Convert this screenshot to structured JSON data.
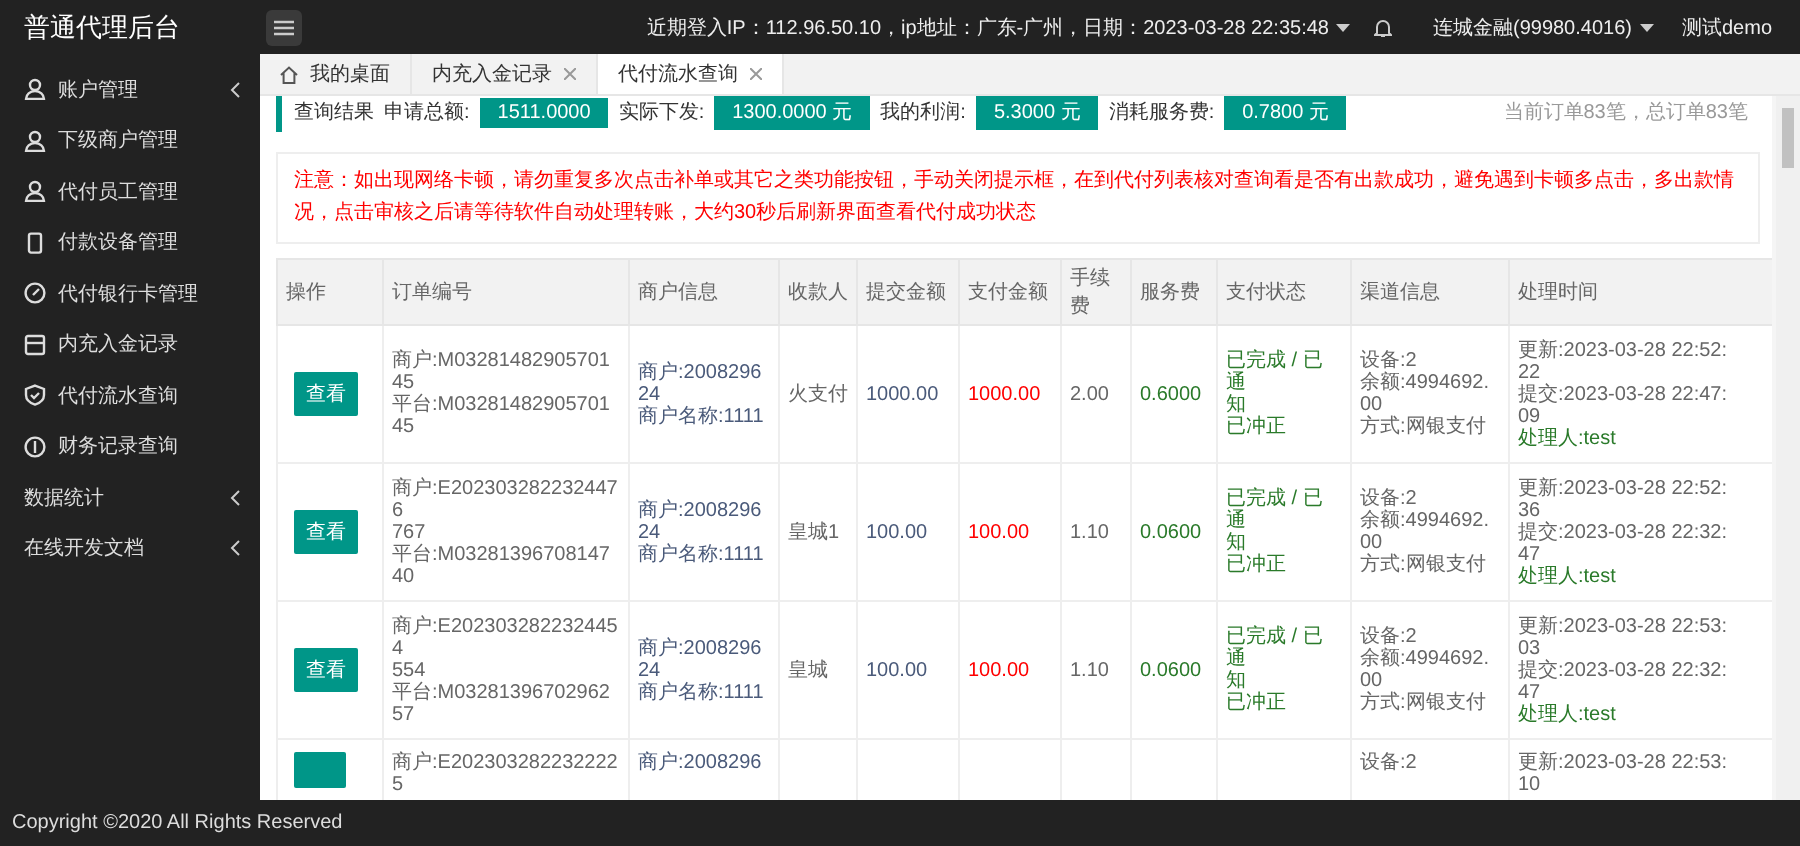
{
  "header": {
    "title": "普通代理后台",
    "login_info": "近期登入IP：112.96.50.10，ip地址：广东-广州，日期：2023-03-28 22:35:48",
    "account": "连城金融(99980.4016)",
    "user": "测试demo"
  },
  "sidebar": {
    "items": [
      {
        "label": "账户管理",
        "has_children": true
      },
      {
        "label": "下级商户管理",
        "has_children": false
      },
      {
        "label": "代付员工管理",
        "has_children": false
      },
      {
        "label": "付款设备管理",
        "has_children": false
      },
      {
        "label": "代付银行卡管理",
        "has_children": false
      },
      {
        "label": "内充入金记录",
        "has_children": false
      },
      {
        "label": "代付流水查询",
        "has_children": false
      },
      {
        "label": "财务记录查询",
        "has_children": false
      },
      {
        "label": "数据统计",
        "has_children": true
      },
      {
        "label": "在线开发文档",
        "has_children": true
      }
    ]
  },
  "tabs": [
    {
      "label": "我的桌面",
      "closable": false,
      "selected": false
    },
    {
      "label": "内充入金记录",
      "closable": true,
      "selected": false
    },
    {
      "label": "代付流水查询",
      "closable": true,
      "selected": true
    }
  ],
  "summary": {
    "title": "查询结果",
    "items": [
      {
        "label": "申请总额:",
        "value": "1511.0000"
      },
      {
        "label": "实际下发:",
        "value": "1300.0000 元"
      },
      {
        "label": "我的利润:",
        "value": "5.3000 元"
      },
      {
        "label": "消耗服务费:",
        "value": "0.7800 元"
      }
    ],
    "count": "当前订单83笔，总订单83笔"
  },
  "notice": "注意：如出现网络卡顿，请勿重复多次点击补单或其它之类功能按钮，手动关闭提示框，在到代付列表核对查询看是否有出款成功，避免遇到卡顿多点击，多出款情况，点击审核之后请等待软件自动处理转账，大约30秒后刷新界面查看代付成功状态",
  "table": {
    "columns": [
      "操作",
      "订单编号",
      "商户信息",
      "收款人",
      "提交金额",
      "支付金额",
      "手续费",
      "服务费",
      "支付状态",
      "渠道信息",
      "处理时间"
    ],
    "rows": [
      {
        "action": "查看",
        "order": [
          "商户:M0328148290570145",
          "平台:M0328148290570145"
        ],
        "merchant": [
          "商户:2008296",
          "24",
          "商户名称:1111"
        ],
        "payee": "火支付",
        "submitted": "1000.00",
        "paid": "1000.00",
        "fee": "2.00",
        "service": "0.6000",
        "status": [
          "已完成 / 已通",
          "知",
          "已冲正"
        ],
        "channel": [
          "设备:2",
          "余额:4994692.",
          "00",
          "方式:网银支付"
        ],
        "time": [
          "更新:2023-03-28 22:52:",
          "22",
          "提交:2023-03-28 22:47:",
          "09"
        ],
        "handler": "处理人:test"
      },
      {
        "action": "查看",
        "order": [
          "商户:E2023032822324476",
          "767",
          "平台:M0328139670814740"
        ],
        "merchant": [
          "商户:2008296",
          "24",
          "商户名称:1111"
        ],
        "payee": "皇城1",
        "submitted": "100.00",
        "paid": "100.00",
        "fee": "1.10",
        "service": "0.0600",
        "status": [
          "已完成 / 已通",
          "知",
          "已冲正"
        ],
        "channel": [
          "设备:2",
          "余额:4994692.",
          "00",
          "方式:网银支付"
        ],
        "time": [
          "更新:2023-03-28 22:52:",
          "36",
          "提交:2023-03-28 22:32:",
          "47"
        ],
        "handler": "处理人:test"
      },
      {
        "action": "查看",
        "order": [
          "商户:E2023032822324454",
          "554",
          "平台:M0328139670296257"
        ],
        "merchant": [
          "商户:2008296",
          "24",
          "商户名称:1111"
        ],
        "payee": "皇城",
        "submitted": "100.00",
        "paid": "100.00",
        "fee": "1.10",
        "service": "0.0600",
        "status": [
          "已完成 / 已通",
          "知",
          "已冲正"
        ],
        "channel": [
          "设备:2",
          "余额:4994692.",
          "00",
          "方式:网银支付"
        ],
        "time": [
          "更新:2023-03-28 22:53:",
          "03",
          "提交:2023-03-28 22:32:",
          "47"
        ],
        "handler": "处理人:test"
      },
      {
        "order": [
          "商户:E2023032822322225"
        ],
        "merchant": [
          "商户:2008296"
        ],
        "channel": [
          "设备:2"
        ],
        "time": [
          "更新:2023-03-28 22:53:",
          "10"
        ]
      }
    ]
  },
  "footer": "Copyright ©2020 All Rights Reserved"
}
